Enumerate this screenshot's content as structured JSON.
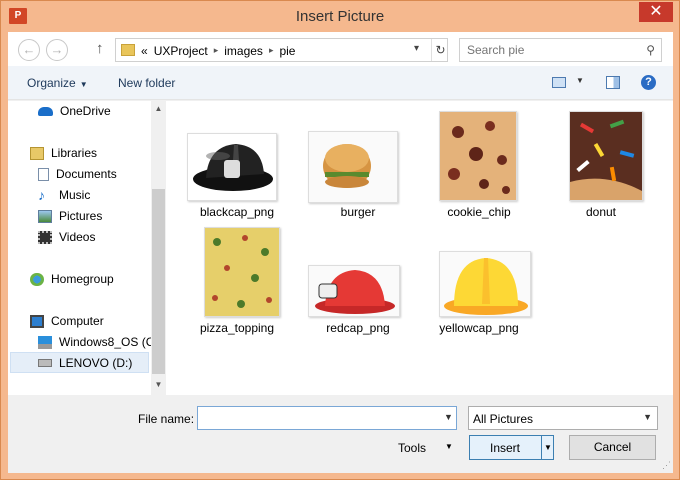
{
  "window": {
    "title": "Insert Picture",
    "app_icon": "P",
    "accent": "#f5b88e",
    "close": "✕"
  },
  "address": {
    "crumbs": [
      "«",
      "UXProject",
      "images",
      "pie"
    ]
  },
  "search": {
    "placeholder": "Search pie"
  },
  "toolbar": {
    "organize": "Organize",
    "new_folder": "New folder"
  },
  "nav": [
    {
      "label": "OneDrive",
      "icon": "cloud-icon"
    },
    {
      "label": "Libraries",
      "icon": "libraries-icon"
    },
    {
      "label": "Documents",
      "icon": "documents-icon"
    },
    {
      "label": "Music",
      "icon": "music-icon"
    },
    {
      "label": "Pictures",
      "icon": "pictures-icon"
    },
    {
      "label": "Videos",
      "icon": "videos-icon"
    },
    {
      "label": "Homegroup",
      "icon": "homegroup-icon"
    },
    {
      "label": "Computer",
      "icon": "computer-icon"
    },
    {
      "label": "Windows8_OS (C",
      "icon": "windows-drive-icon"
    },
    {
      "label": "LENOVO (D:)",
      "icon": "drive-icon",
      "selected": true
    }
  ],
  "files": [
    {
      "name": "blackcap_png"
    },
    {
      "name": "burger"
    },
    {
      "name": "cookie_chip"
    },
    {
      "name": "donut"
    },
    {
      "name": "pizza_topping"
    },
    {
      "name": "redcap_png"
    },
    {
      "name": "yellowcap_png"
    }
  ],
  "bottom": {
    "file_name_label": "File name:",
    "file_name_value": "",
    "filter": "All Pictures",
    "tools": "Tools",
    "insert": "Insert",
    "cancel": "Cancel"
  }
}
